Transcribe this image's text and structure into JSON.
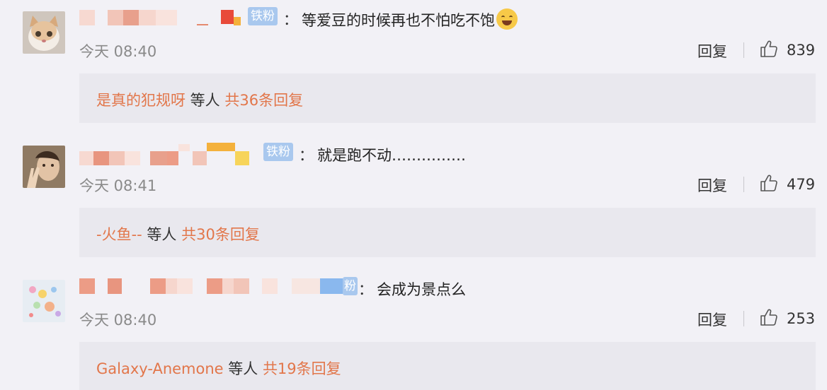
{
  "comments": [
    {
      "badge": "铁粉",
      "colon": "：",
      "text": "等爱豆的时候再也不怕吃不饱",
      "emoji": "laughing-tears-emoji",
      "time": "今天 08:40",
      "reply_label": "回复",
      "likes": "839",
      "reply_summary": {
        "users": "是真的犯规呀",
        "middle": " 等人 ",
        "count": "共36条回复"
      }
    },
    {
      "badge": "铁粉",
      "colon": "：",
      "text": "就是跑不动……………",
      "time": "今天 08:41",
      "reply_label": "回复",
      "likes": "479",
      "reply_summary": {
        "users": "-火鱼--",
        "middle": " 等人 ",
        "count": "共30条回复"
      }
    },
    {
      "badge": "粉",
      "colon": "：",
      "text": "会成为景点么",
      "time": "今天 08:40",
      "reply_label": "回复",
      "likes": "253",
      "reply_summary": {
        "users": "Galaxy-Anemone",
        "middle": " 等人 ",
        "count": "共19条回复"
      }
    }
  ],
  "colors": {
    "accent": "#e2764a",
    "badge": "#a9c8ee",
    "background": "#f2f1f6",
    "reply_box": "#e9e8ee"
  }
}
